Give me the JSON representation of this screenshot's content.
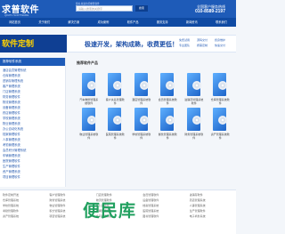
{
  "header": {
    "logo": "求普软件",
    "logo_sub": "QIUPU SOFTWARE",
    "search_hint": "您好,欢迎访问求普软件",
    "search_placeholder": "请输入搜索的关键字",
    "search_button": "搜索",
    "hotline_label": "全国客户服务热线",
    "hotline_number": "010-8589-2197"
  },
  "nav": [
    "网站首页",
    "关于我们",
    "解决方案",
    "成功案例",
    "软件产品",
    "服务支持",
    "新闻资讯",
    "联系我们"
  ],
  "banner": {
    "left": "软件定制",
    "slogan": "极速开发，架构成熟，收费更低！",
    "badges": [
      "免费试用",
      "源码交付",
      "终身维护",
      "专业团队",
      "按需定制",
      "快速交付"
    ]
  },
  "sidebar": {
    "title": "推荐软件系统",
    "items": [
      "酒店会员管理系统",
      "仓库管理系统",
      "进销存管理系统",
      "客户管理系统",
      "门店管理系统",
      "财务管理软件",
      "物流管理系统",
      "设备管理系统",
      "药店管理软件",
      "学校管理系统",
      "物业管理系统",
      "办公自动化系统",
      "档案管理软件",
      "人事管理系统",
      "考勤管理系统",
      "会员积分管理系统",
      "车辆管理系统",
      "医院管理软件",
      "生产管理软件",
      "资产管理系统",
      "项目管理软件"
    ]
  },
  "main": {
    "title": "推荐软件产品",
    "products": [
      "汽车维修管理系统软件",
      "客户关系管理软件",
      "酒店管理系统软件",
      "会员管理系统软件",
      "进销存管理系统软件",
      "仓库管理系统软件",
      "物业管理系统软件",
      "医院管理系统软件",
      "学校管理系统软件",
      "餐饮管理系统软件",
      "财务管理系统软件",
      "资产管理系统软件"
    ]
  },
  "footer_links": [
    "软件定制开发",
    "客户管理软件",
    "门店管理软件",
    "会员管理软件",
    "进销存软件",
    "仓库管理系统",
    "财务管理系统",
    "物流管理软件",
    "设备管理软件",
    "药店管理系统",
    "学校管理系统",
    "物业管理软件",
    "办公自动化",
    "档案管理系统",
    "人事管理系统",
    "考勤管理软件",
    "积分管理系统",
    "车辆管理系统",
    "医院管理系统",
    "生产管理软件",
    "资产管理系统",
    "项目管理系统",
    "合同管理系统",
    "图书管理软件",
    "电子商务系统"
  ],
  "watermark": "便民库"
}
